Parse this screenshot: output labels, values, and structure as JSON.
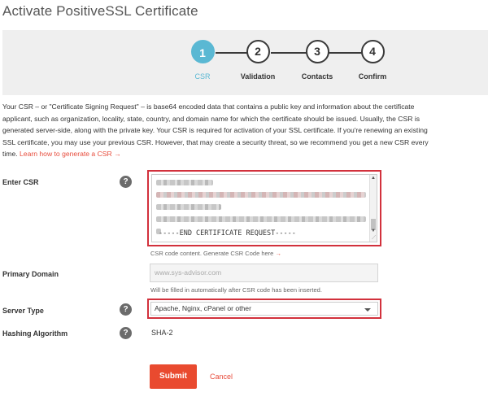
{
  "page": {
    "title": "Activate PositiveSSL Certificate"
  },
  "stepper": {
    "steps": [
      {
        "number": "1",
        "label": "CSR",
        "active": true
      },
      {
        "number": "2",
        "label": "Validation",
        "active": false
      },
      {
        "number": "3",
        "label": "Contacts",
        "active": false
      },
      {
        "number": "4",
        "label": "Confirm",
        "active": false
      }
    ]
  },
  "intro": {
    "text": "Your CSR – or \"Certificate Signing Request\" – is base64 encoded data that contains a public key and information about the certificate applicant, such as organization, locality, state, country, and domain name for which the certificate should be issued. Usually, the CSR is generated server-side, along with the private key. Your CSR is required for activation of your SSL certificate. If you're renewing an existing SSL certificate, you may use your previous CSR. However, that may create a security threat, so we recommend you get a new CSR every time.",
    "link": "Learn how to generate a CSR →"
  },
  "form": {
    "csr": {
      "label": "Enter CSR",
      "help": "?",
      "end_line": "-----END CERTIFICATE REQUEST-----",
      "hint": "CSR code content. Generate CSR Code here",
      "hint_link": "→"
    },
    "domain": {
      "label": "Primary Domain",
      "value": "www.sys-advisor.com",
      "hint": "Will be filled in automatically after CSR code has been inserted."
    },
    "server_type": {
      "label": "Server Type",
      "help": "?",
      "selected": "Apache, Nginx, cPanel or other"
    },
    "hashing": {
      "label": "Hashing Algorithm",
      "help": "?",
      "value": "SHA-2"
    },
    "submit_label": "Submit",
    "cancel_label": "Cancel"
  },
  "colors": {
    "accent": "#5ab8d3",
    "danger": "#e94a2f",
    "highlight_border": "#d2313c"
  }
}
